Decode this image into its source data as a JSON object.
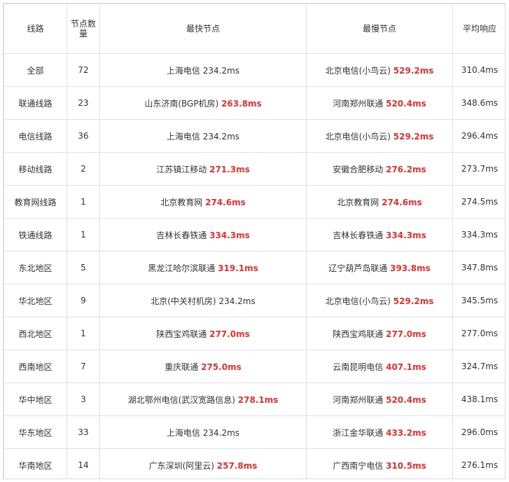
{
  "header": {
    "line": "线路",
    "count": "节点数量",
    "fastest": "最快节点",
    "slowest": "最慢节点",
    "avg": "平均响应"
  },
  "rows": [
    {
      "line": "全部",
      "count": "72",
      "fast_node": "上海电信",
      "fast_ms": "234.2ms",
      "fast_hl": false,
      "slow_node": "北京电信(小鸟云)",
      "slow_ms": "529.2ms",
      "slow_hl": true,
      "avg": "310.4ms"
    },
    {
      "line": "联通线路",
      "count": "23",
      "fast_node": "山东济南(BGP机房)",
      "fast_ms": "263.8ms",
      "fast_hl": true,
      "slow_node": "河南郑州联通",
      "slow_ms": "520.4ms",
      "slow_hl": true,
      "avg": "348.6ms"
    },
    {
      "line": "电信线路",
      "count": "36",
      "fast_node": "上海电信",
      "fast_ms": "234.2ms",
      "fast_hl": false,
      "slow_node": "北京电信(小鸟云)",
      "slow_ms": "529.2ms",
      "slow_hl": true,
      "avg": "296.4ms"
    },
    {
      "line": "移动线路",
      "count": "2",
      "fast_node": "江苏镇江移动",
      "fast_ms": "271.3ms",
      "fast_hl": true,
      "slow_node": "安徽合肥移动",
      "slow_ms": "276.2ms",
      "slow_hl": true,
      "avg": "273.7ms"
    },
    {
      "line": "教育网线路",
      "count": "1",
      "fast_node": "北京教育网",
      "fast_ms": "274.6ms",
      "fast_hl": true,
      "slow_node": "北京教育网",
      "slow_ms": "274.6ms",
      "slow_hl": true,
      "avg": "274.5ms"
    },
    {
      "line": "铁通线路",
      "count": "1",
      "fast_node": "吉林长春铁通",
      "fast_ms": "334.3ms",
      "fast_hl": true,
      "slow_node": "吉林长春铁通",
      "slow_ms": "334.3ms",
      "slow_hl": true,
      "avg": "334.3ms"
    },
    {
      "line": "东北地区",
      "count": "5",
      "fast_node": "黑龙江哈尔滨联通",
      "fast_ms": "319.1ms",
      "fast_hl": true,
      "slow_node": "辽宁葫芦岛联通",
      "slow_ms": "393.8ms",
      "slow_hl": true,
      "avg": "347.8ms"
    },
    {
      "line": "华北地区",
      "count": "9",
      "fast_node": "北京(中关村机房)",
      "fast_ms": "234.2ms",
      "fast_hl": false,
      "slow_node": "北京电信(小鸟云)",
      "slow_ms": "529.2ms",
      "slow_hl": true,
      "avg": "345.5ms"
    },
    {
      "line": "西北地区",
      "count": "1",
      "fast_node": "陕西宝鸡联通",
      "fast_ms": "277.0ms",
      "fast_hl": true,
      "slow_node": "陕西宝鸡联通",
      "slow_ms": "277.0ms",
      "slow_hl": true,
      "avg": "277.0ms"
    },
    {
      "line": "西南地区",
      "count": "7",
      "fast_node": "重庆联通",
      "fast_ms": "275.0ms",
      "fast_hl": true,
      "slow_node": "云南昆明电信",
      "slow_ms": "407.1ms",
      "slow_hl": true,
      "avg": "324.7ms"
    },
    {
      "line": "华中地区",
      "count": "3",
      "fast_node": "湖北鄂州电信(武汉宽路信息)",
      "fast_ms": "278.1ms",
      "fast_hl": true,
      "slow_node": "河南郑州联通",
      "slow_ms": "520.4ms",
      "slow_hl": true,
      "avg": "438.1ms"
    },
    {
      "line": "华东地区",
      "count": "33",
      "fast_node": "上海电信",
      "fast_ms": "234.2ms",
      "fast_hl": false,
      "slow_node": "浙江金华联通",
      "slow_ms": "433.2ms",
      "slow_hl": true,
      "avg": "296.0ms"
    },
    {
      "line": "华南地区",
      "count": "14",
      "fast_node": "广东深圳(阿里云)",
      "fast_ms": "257.8ms",
      "fast_hl": true,
      "slow_node": "广西南宁电信",
      "slow_ms": "310.5ms",
      "slow_hl": true,
      "avg": "276.1ms"
    }
  ],
  "colors": {
    "highlight": "#e8302f",
    "text": "#333333",
    "border": "#e1e1e1"
  }
}
